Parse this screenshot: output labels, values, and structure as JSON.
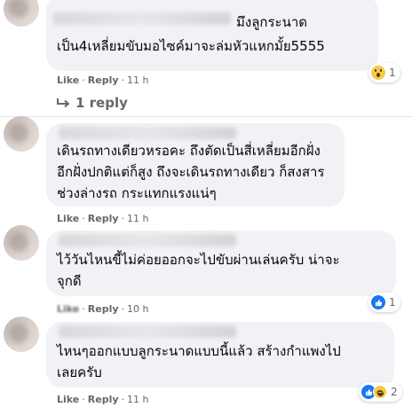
{
  "comments": [
    {
      "text_lines": [
        "มึงลูกระนาด",
        "เป็น4เหลี่ยมขับมอไซค์มาจะล่มหัวแหกมั้ย5555"
      ],
      "like": "Like",
      "reply": "Reply",
      "time": "11 h",
      "reaction_count": "1",
      "replies_label": "1 reply"
    },
    {
      "text_lines": [
        "เดินรถทางเดียวหรอคะ ถึงตัดเป็นสี่เหลี่ยมอีกฝั่ง",
        "อีกฝั่งปกติแต่ก็สูง ถึงจะเดินรถทางเดียว ก็สงสาร",
        "ช่วงล่างรถ กระแทกแรงแน่ๆ"
      ],
      "like": "Like",
      "reply": "Reply",
      "time": "11 h"
    },
    {
      "text_lines": [
        "ไว้วันไหนขี้ไม่ค่อยออกจะไปขับผ่านเล่นครับ น่าจะ",
        "จุกดี"
      ],
      "like": "Like",
      "reply": "Reply",
      "time": "10 h",
      "reaction_count": "1"
    },
    {
      "text_lines": [
        "ไหนๆออกแบบลูกระนาดแบบนี้แล้ว สร้างกำแพงไป",
        "เลยครับ"
      ],
      "like": "Like",
      "reply": "Reply",
      "time": "11 h",
      "reaction_count": "2"
    }
  ],
  "icons": {
    "reply_arrow": "reply-arrow-icon",
    "wow": "wow-reaction-icon",
    "like": "like-reaction-icon",
    "haha": "haha-reaction-icon"
  },
  "colors": {
    "bubble": "#f0f2f5",
    "meta_text": "#65676b",
    "like_blue": "#1877f2",
    "reaction_yellow": "#f7c748"
  }
}
